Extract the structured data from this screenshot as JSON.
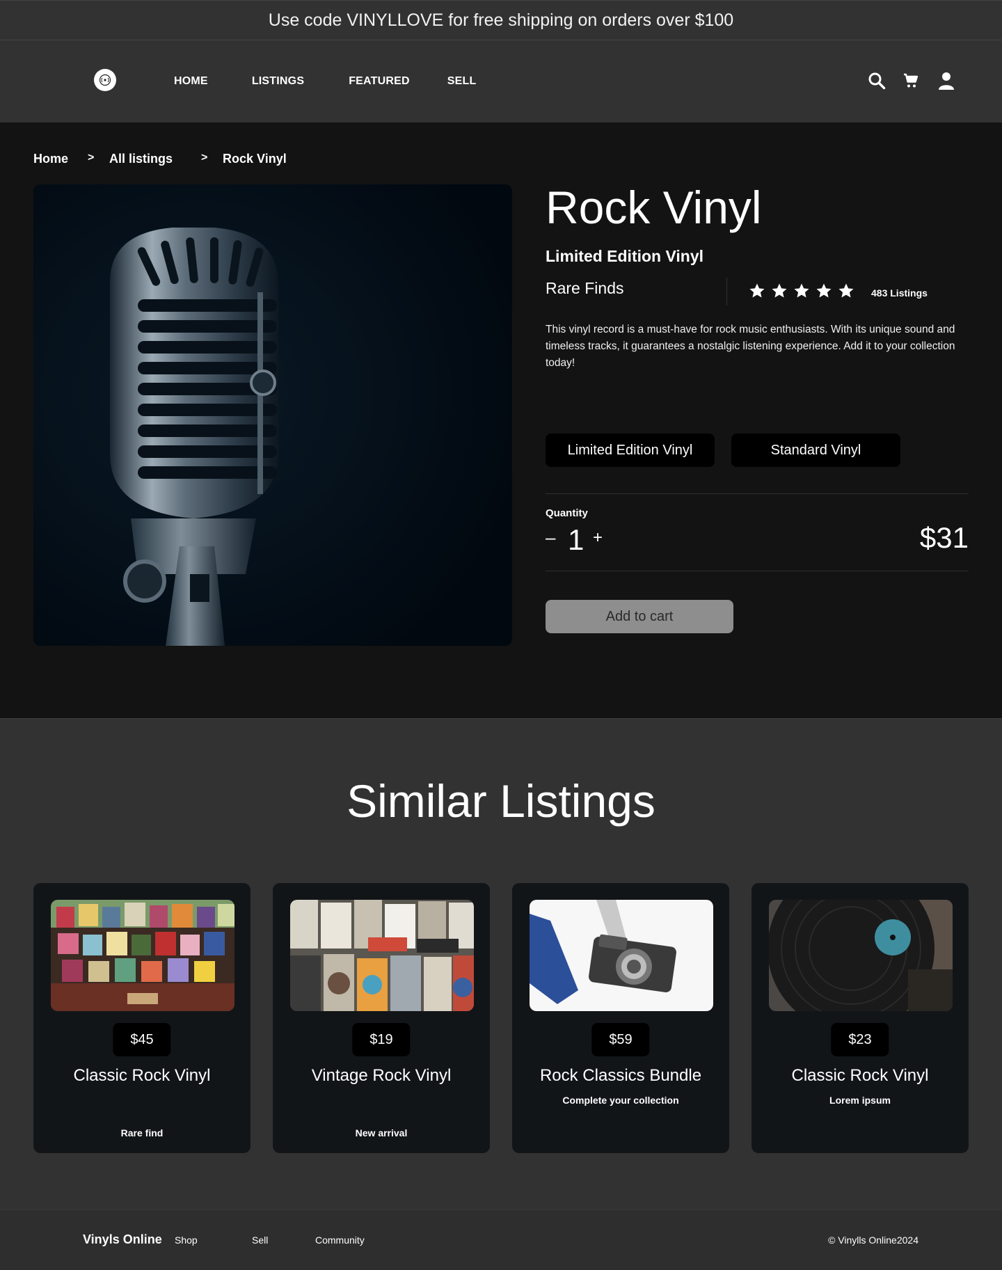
{
  "promo_text": "Use code VINYLLOVE for free shipping on orders over $100",
  "header": {
    "nav": [
      "HOME",
      "LISTINGS",
      "FEATURED",
      "SELL"
    ],
    "icons": [
      "search-icon",
      "cart-icon",
      "user-icon"
    ]
  },
  "breadcrumb": {
    "items": [
      "Home",
      "All listings",
      "Rock Vinyl"
    ],
    "separator": ">"
  },
  "product": {
    "title": "Rock Vinyl",
    "subtitle": "Limited Edition Vinyl",
    "brand": "Rare Finds",
    "rating": 5,
    "listings_count": "483 Listings",
    "description": "This vinyl record is a must-have for rock music enthusiasts. With its unique sound and timeless tracks, it guarantees a nostalgic listening experience. Add it to your collection today!",
    "variants": [
      "Limited Edition Vinyl",
      "Standard Vinyl"
    ],
    "quantity_label": "Quantity",
    "quantity_minus": "–",
    "quantity": "1",
    "quantity_plus": "+",
    "price": "$31",
    "add_to_cart": "Add to cart",
    "image": "microphone-photo"
  },
  "similar": {
    "title": "Similar Listings",
    "items": [
      {
        "price": "$45",
        "title": "Classic Rock Vinyl",
        "tag": "Rare find",
        "image": "record-crates-photo"
      },
      {
        "price": "$19",
        "title": "Vintage Rock Vinyl",
        "tag": "New arrival",
        "image": "record-store-photo"
      },
      {
        "price": "$59",
        "title": "Rock Classics Bundle",
        "tag": "Complete your collection",
        "image": "camera-photo"
      },
      {
        "price": "$23",
        "title": "Classic Rock Vinyl",
        "tag": "Lorem ipsum",
        "image": "turntable-photo"
      }
    ]
  },
  "footer": {
    "brand": "Vinyls Online",
    "links": [
      "Shop",
      "Sell",
      "Community"
    ],
    "copyright": "© Vinylls Online2024"
  },
  "colors": {
    "page_bg": "#131313",
    "band_bg": "#323232",
    "card_bg": "#121518",
    "button_bg": "#000000",
    "add_to_cart_bg": "#8e8e8e"
  }
}
